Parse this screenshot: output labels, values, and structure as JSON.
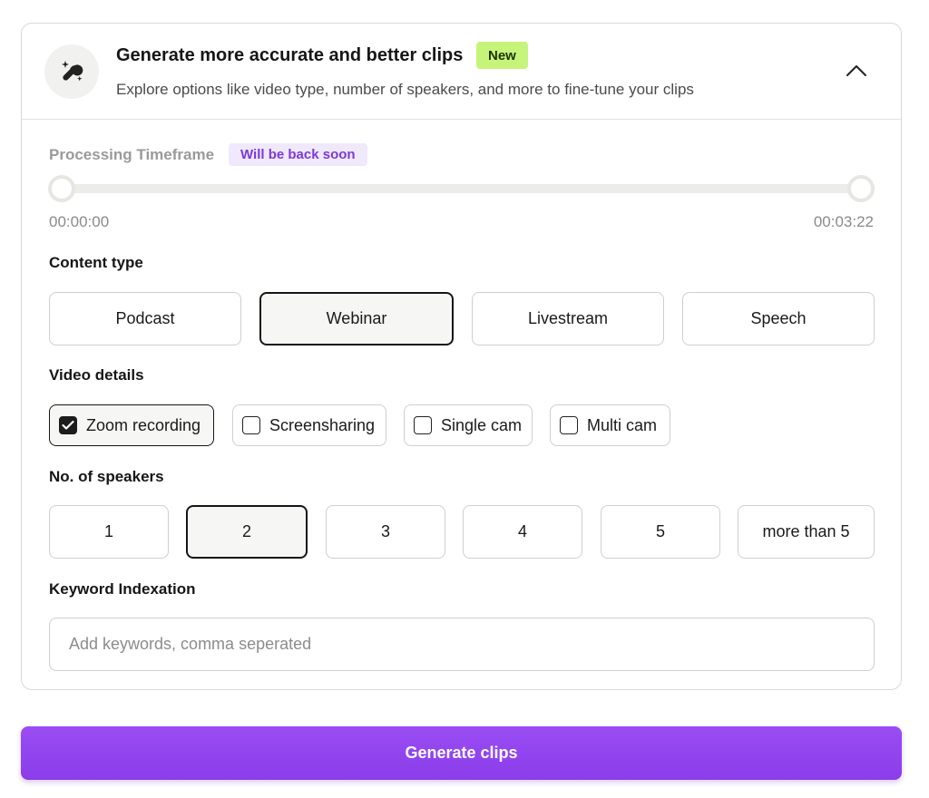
{
  "header": {
    "title": "Generate more accurate and better clips",
    "badge": "New",
    "subtitle": "Explore options like video type, number of speakers, and more to fine-tune your clips",
    "icon": "magic-wrench-icon",
    "collapse_icon": "chevron-up-icon"
  },
  "timeframe": {
    "label": "Processing Timeframe",
    "badge": "Will be back soon",
    "start": "00:00:00",
    "end": "00:03:22"
  },
  "content_type": {
    "label": "Content type",
    "options": [
      "Podcast",
      "Webinar",
      "Livestream",
      "Speech"
    ],
    "selected": "Webinar"
  },
  "video_details": {
    "label": "Video details",
    "options": [
      {
        "label": "Zoom recording",
        "checked": true
      },
      {
        "label": "Screensharing",
        "checked": false
      },
      {
        "label": "Single cam",
        "checked": false
      },
      {
        "label": "Multi cam",
        "checked": false
      }
    ]
  },
  "speakers": {
    "label": "No. of speakers",
    "options": [
      "1",
      "2",
      "3",
      "4",
      "5",
      "more than 5"
    ],
    "selected": "2"
  },
  "keywords": {
    "label": "Keyword Indexation",
    "placeholder": "Add keywords, comma seperated",
    "value": ""
  },
  "generate_label": "Generate clips",
  "colors": {
    "accent": "#8a3de9",
    "new_badge_bg": "#c6f47a",
    "soon_badge_bg": "#f0e8fb",
    "soon_badge_text": "#7c3ad7"
  }
}
